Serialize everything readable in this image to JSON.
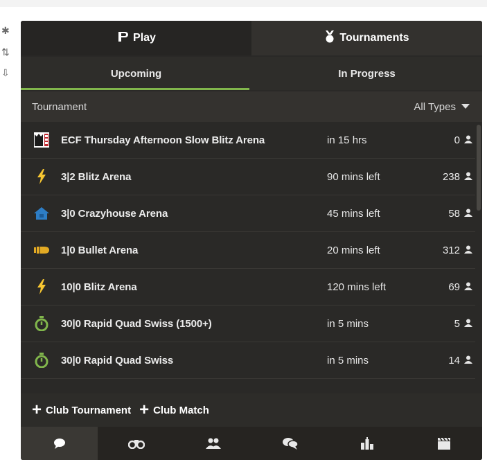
{
  "play_tab": {
    "label": "Play",
    "icon": "pawn-icon"
  },
  "tournaments_tab": {
    "label": "Tournaments",
    "icon": "medal-icon"
  },
  "sub_tabs": {
    "upcoming": "Upcoming",
    "in_progress": "In Progress"
  },
  "list_header": {
    "column": "Tournament",
    "filter": "All Types"
  },
  "rows": [
    {
      "icon": "ecf-logo-icon",
      "name": "ECF Thursday Afternoon Slow Blitz Arena",
      "time": "in 15 hrs",
      "count": "0"
    },
    {
      "icon": "lightning-icon",
      "name": "3|2 Blitz Arena",
      "time": "90 mins left",
      "count": "238"
    },
    {
      "icon": "crazyhouse-icon",
      "name": "3|0 Crazyhouse Arena",
      "time": "45 mins left",
      "count": "58"
    },
    {
      "icon": "bullet-icon",
      "name": "1|0 Bullet Arena",
      "time": "20 mins left",
      "count": "312"
    },
    {
      "icon": "lightning-icon",
      "name": "10|0 Blitz Arena",
      "time": "120 mins left",
      "count": "69"
    },
    {
      "icon": "stopwatch-icon",
      "name": "30|0 Rapid Quad Swiss (1500+)",
      "time": "in 5 mins",
      "count": "5"
    },
    {
      "icon": "stopwatch-icon",
      "name": "30|0 Rapid Quad Swiss",
      "time": "in 5 mins",
      "count": "14"
    }
  ],
  "actions": {
    "club_tournament": "Club Tournament",
    "club_match": "Club Match"
  },
  "bottom_nav": [
    "chat-icon",
    "binoculars-icon",
    "users-icon",
    "messages-icon",
    "leaderboard-icon",
    "clapperboard-icon"
  ],
  "colors": {
    "accent_green": "#81b64c",
    "lightning": "#f7c631",
    "bullet": "#e3aa24",
    "stopwatch": "#81b64c",
    "crazyhouse": "#2d7dc5",
    "panel_bg": "#2a2927"
  }
}
